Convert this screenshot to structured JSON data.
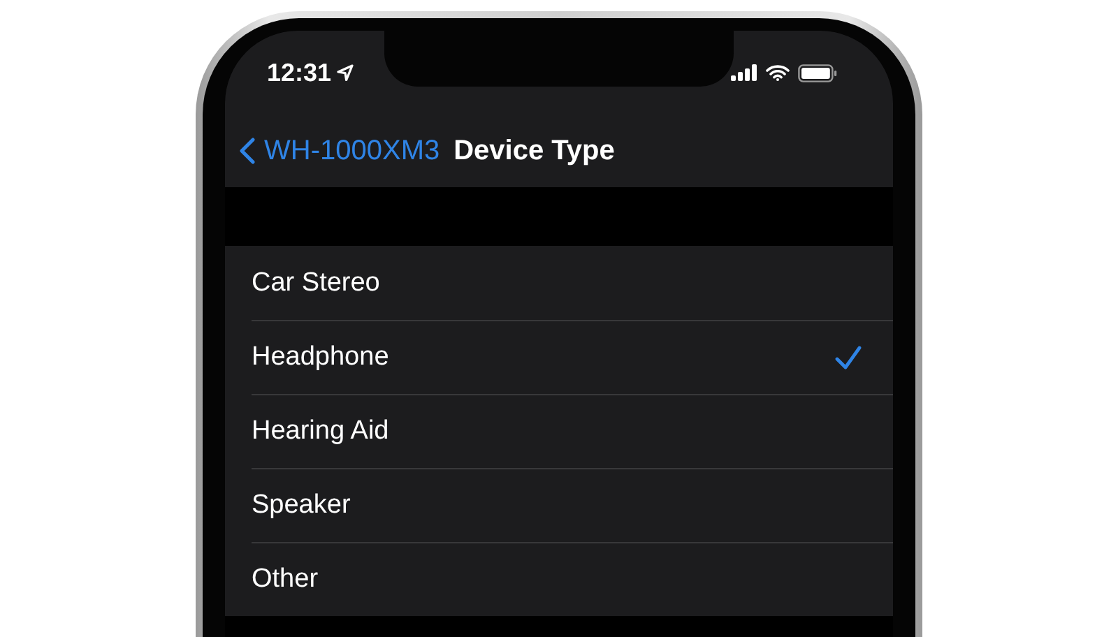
{
  "status_bar": {
    "time": "12:31"
  },
  "nav_bar": {
    "back_label": "WH-1000XM3",
    "title": "Device Type"
  },
  "options": [
    {
      "label": "Car Stereo",
      "selected": false
    },
    {
      "label": "Headphone",
      "selected": true
    },
    {
      "label": "Hearing Aid",
      "selected": false
    },
    {
      "label": "Speaker",
      "selected": false
    },
    {
      "label": "Other",
      "selected": false
    }
  ]
}
